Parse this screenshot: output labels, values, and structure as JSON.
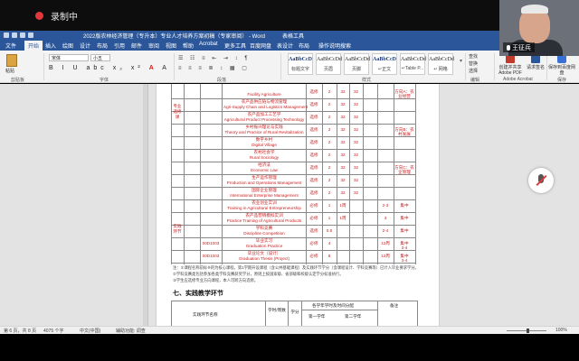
{
  "recording": {
    "label": "录制中"
  },
  "window": {
    "title": "2022版农林经济管理（专升本）专业人才培养方案初稿（专家审阅） - Word",
    "context_tab": "表格工具"
  },
  "ribbon_tabs": [
    "文件",
    "开始",
    "插入",
    "绘图",
    "设计",
    "布局",
    "引用",
    "邮件",
    "审阅",
    "视图",
    "帮助",
    "Acrobat",
    "更多工具",
    "百度网盘",
    "表设计",
    "布局",
    "操作说明搜索"
  ],
  "clipboard": {
    "paste": "粘贴",
    "group": "剪贴板"
  },
  "font": {
    "name": "宋体",
    "size": "小五",
    "group": "字体"
  },
  "paragraph": {
    "group": "段落"
  },
  "styles": {
    "group": "样式",
    "items": [
      {
        "sample": "AaBbCcD",
        "name": "标题文字"
      },
      {
        "sample": "AaBbCcDd",
        "name": "页眉"
      },
      {
        "sample": "AaBbCcDd",
        "name": "页脚"
      },
      {
        "sample": "AaBbCcD",
        "name": "↵正文"
      },
      {
        "sample": "AaBbCcDd",
        "name": "↵Table P..."
      },
      {
        "sample": "AaBbCcDd",
        "name": "↵ 网格"
      }
    ]
  },
  "editing": {
    "find": "查找",
    "replace": "替换",
    "select": "选择",
    "group": "编辑"
  },
  "acrobat": {
    "create": "创建并共享 Adobe PDF",
    "request": "请求签名",
    "group": "Adobe Acrobat"
  },
  "baidu": {
    "save": "保存到百度网盘",
    "group": "保存"
  },
  "speaker": {
    "name": "王征兵"
  },
  "document": {
    "rows": [
      {
        "en": "Facility Agriculture",
        "zh": "",
        "type": "选修",
        "c1": "2",
        "c2": "32",
        "c3": "32",
        "c4": "",
        "term": "",
        "dir": "方向A：农业经营"
      },
      {
        "en": "Agri-Supply Chain and Logistics Management",
        "zh": "农产品供应链与物流管理",
        "type": "选修",
        "c1": "2",
        "c2": "32",
        "c3": "32",
        "c4": "",
        "term": "",
        "dir": ""
      },
      {
        "en": "Agricultural Product Processing Technology",
        "zh": "农产品加工工艺学",
        "type": "选修",
        "c1": "2",
        "c2": "32",
        "c3": "32",
        "c4": "",
        "term": "",
        "dir": ""
      },
      {
        "en": "Theory and Practice of Rural Revitalization",
        "zh": "乡村振兴理论与实践",
        "type": "选修",
        "c1": "2",
        "c2": "32",
        "c3": "32",
        "c4": "",
        "term": "",
        "dir": "方向B：农村发展"
      },
      {
        "en": "Digital Village",
        "zh": "数字乡村",
        "type": "选修",
        "c1": "2",
        "c2": "32",
        "c3": "32",
        "c4": "",
        "term": "",
        "dir": ""
      },
      {
        "en": "Rural Sociology",
        "zh": "农村社会学",
        "type": "选修",
        "c1": "2",
        "c2": "32",
        "c3": "32",
        "c4": "",
        "term": "",
        "dir": ""
      },
      {
        "en": "Economic Law",
        "zh": "经济法",
        "type": "选修",
        "c1": "2",
        "c2": "32",
        "c3": "32",
        "c4": "",
        "term": "",
        "dir": "方向C：农企管理"
      },
      {
        "en": "Production and Operations Management",
        "zh": "生产运作管理",
        "type": "选修",
        "c1": "2",
        "c2": "32",
        "c3": "32",
        "c4": "",
        "term": "",
        "dir": ""
      },
      {
        "en": "International Enterprise Management",
        "zh": "国际企业管理",
        "type": "选修",
        "c1": "2",
        "c2": "32",
        "c3": "32",
        "c4": "",
        "term": "",
        "dir": ""
      },
      {
        "en": "Training in Agricultural Entrepreneurship",
        "zh": "农业创业实训",
        "type": "必修",
        "c1": "1",
        "c2": "1周",
        "c3": "",
        "c4": "",
        "term": "2-3",
        "dir": "集中"
      },
      {
        "en": "Practice Training of Agricultural Products",
        "zh": "农产品营销模拟实训",
        "type": "必修",
        "c1": "1",
        "c2": "1周",
        "c3": "",
        "c4": "",
        "term": "3",
        "dir": "集中"
      },
      {
        "en": "Discipline Competition",
        "zh": "学科竞赛",
        "type": "选修",
        "c1": "0.5",
        "c2": "",
        "c3": "",
        "c4": "",
        "term": "2-4",
        "dir": "集中"
      },
      {
        "en": "Graduation Practice",
        "zh": "毕业实习",
        "code": "00D1003",
        "type": "必修",
        "c1": "4",
        "c2": "",
        "c3": "",
        "c4": "",
        "term": "12周",
        "extra": "3-4",
        "dir": "集中"
      },
      {
        "en": "Graduation Thesis (Project)",
        "zh": "毕业论文（设计）",
        "code": "00D1003",
        "type": "必修",
        "c1": "8",
        "c2": "",
        "c3": "",
        "c4": "",
        "term": "12周",
        "extra": "3-4",
        "dir": "集中"
      }
    ],
    "group_labels": {
      "major_elective": "专业选修课",
      "practice": "实践环节"
    },
    "notes": [
      "注：①课程名称前标※的为核心课程，第1学期开设课程（含公共基础课程）及实践环节学分（含课程设计、学科竞赛等）已计入毕业要求学分。",
      "②学科竞赛类包括参加各类学科竞赛获奖学分，原则上按国家级、省部级和校级认定学分标准执行。",
      "③学生应选修专业方向课程，本人可跨方向选修。"
    ],
    "section7_title": "七、实践教学环节",
    "sec7_headers": {
      "name": "实践环节名称",
      "credit": "学时/周数",
      "score": "学分",
      "distribution": "各学年学时及时间分配",
      "year1": "第一学年",
      "year2": "第二学年",
      "remark": "备注"
    }
  },
  "statusbar": {
    "page": "第 6 页，共 8 页",
    "words": "4075 个字",
    "lang": "中文(中国)",
    "access": "辅助功能: 调查",
    "zoom": "100%"
  }
}
